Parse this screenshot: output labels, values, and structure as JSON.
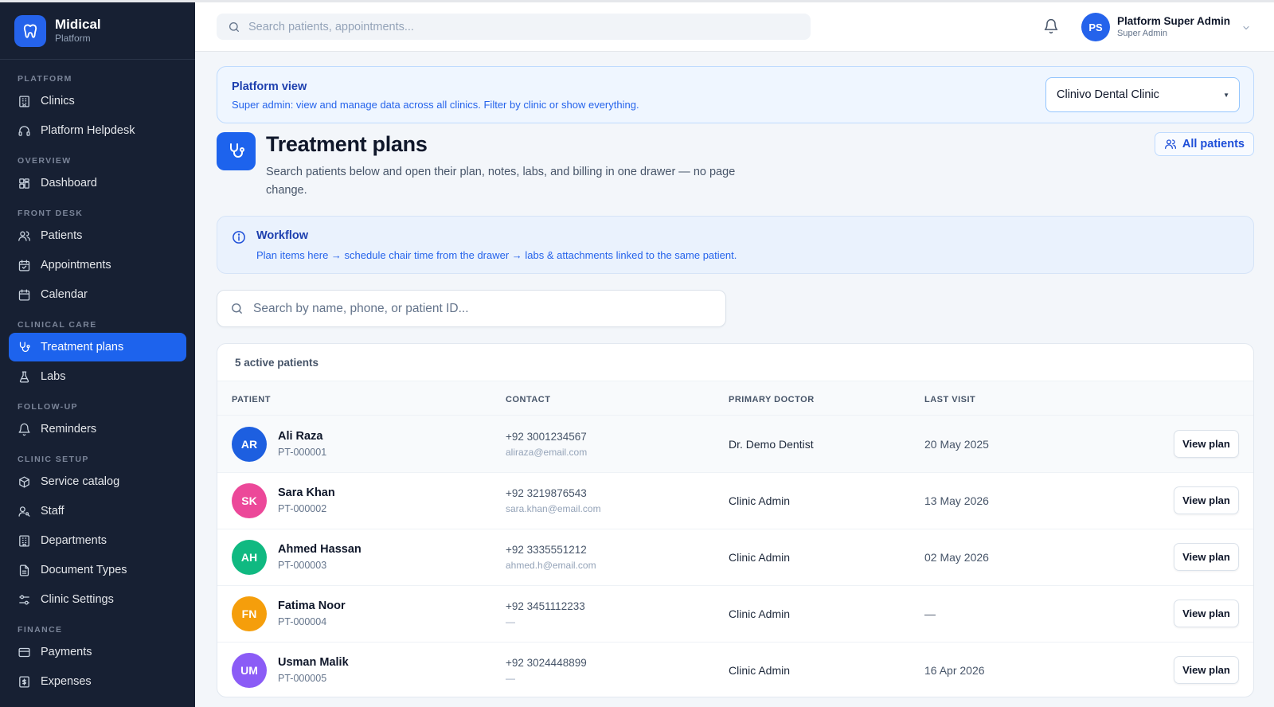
{
  "brand": {
    "name": "Midical",
    "subtitle": "Platform"
  },
  "sidebar": {
    "sections": [
      {
        "title": "PLATFORM",
        "items": [
          {
            "label": "Clinics",
            "icon": "building-icon"
          },
          {
            "label": "Platform Helpdesk",
            "icon": "headset-icon"
          }
        ]
      },
      {
        "title": "OVERVIEW",
        "items": [
          {
            "label": "Dashboard",
            "icon": "grid-icon"
          }
        ]
      },
      {
        "title": "FRONT DESK",
        "items": [
          {
            "label": "Patients",
            "icon": "users-icon"
          },
          {
            "label": "Appointments",
            "icon": "calendar-check-icon"
          },
          {
            "label": "Calendar",
            "icon": "calendar-icon"
          }
        ]
      },
      {
        "title": "CLINICAL CARE",
        "items": [
          {
            "label": "Treatment plans",
            "icon": "stethoscope-icon",
            "active": true
          },
          {
            "label": "Labs",
            "icon": "flask-icon"
          }
        ]
      },
      {
        "title": "FOLLOW-UP",
        "items": [
          {
            "label": "Reminders",
            "icon": "bell-icon"
          }
        ]
      },
      {
        "title": "CLINIC SETUP",
        "items": [
          {
            "label": "Service catalog",
            "icon": "package-icon"
          },
          {
            "label": "Staff",
            "icon": "user-key-icon"
          },
          {
            "label": "Departments",
            "icon": "building-icon"
          },
          {
            "label": "Document Types",
            "icon": "document-icon"
          },
          {
            "label": "Clinic Settings",
            "icon": "sliders-icon"
          }
        ]
      },
      {
        "title": "FINANCE",
        "items": [
          {
            "label": "Payments",
            "icon": "credit-card-icon"
          },
          {
            "label": "Expenses",
            "icon": "receipt-icon"
          }
        ]
      }
    ]
  },
  "topbar": {
    "search_placeholder": "Search patients, appointments...",
    "user": {
      "initials": "PS",
      "name": "Platform Super Admin",
      "role": "Super Admin"
    }
  },
  "platform_view": {
    "title": "Platform view",
    "description": "Super admin: view and manage data across all clinics. Filter by clinic or show everything.",
    "selected_clinic": "Clinivo Dental Clinic"
  },
  "page": {
    "title": "Treatment plans",
    "description": "Search patients below and open their plan, notes, labs, and billing in one drawer — no page change.",
    "all_patients_label": "All patients"
  },
  "workflow": {
    "title": "Workflow",
    "description": "Plan items here → schedule chair time from the drawer → labs & attachments linked to the same patient."
  },
  "patient_search": {
    "placeholder": "Search by name, phone, or patient ID..."
  },
  "table": {
    "count_label": "5 active patients",
    "headers": {
      "patient": "PATIENT",
      "contact": "CONTACT",
      "doctor": "PRIMARY DOCTOR",
      "last_visit": "LAST VISIT"
    },
    "action_label": "View plan",
    "rows": [
      {
        "initials": "AR",
        "color": "#1d5fe0",
        "name": "Ali Raza",
        "id": "PT-000001",
        "phone": "+92 3001234567",
        "email": "aliraza@email.com",
        "doctor": "Dr. Demo Dentist",
        "last_visit": "20 May 2025"
      },
      {
        "initials": "SK",
        "color": "#ec4899",
        "name": "Sara Khan",
        "id": "PT-000002",
        "phone": "+92 3219876543",
        "email": "sara.khan@email.com",
        "doctor": "Clinic Admin",
        "last_visit": "13 May 2026"
      },
      {
        "initials": "AH",
        "color": "#10b981",
        "name": "Ahmed Hassan",
        "id": "PT-000003",
        "phone": "+92 3335551212",
        "email": "ahmed.h@email.com",
        "doctor": "Clinic Admin",
        "last_visit": "02 May 2026"
      },
      {
        "initials": "FN",
        "color": "#f59e0b",
        "name": "Fatima Noor",
        "id": "PT-000004",
        "phone": "+92 3451112233",
        "email": "—",
        "doctor": "Clinic Admin",
        "last_visit": "—"
      },
      {
        "initials": "UM",
        "color": "#8b5cf6",
        "name": "Usman Malik",
        "id": "PT-000005",
        "phone": "+92 3024448899",
        "email": "—",
        "doctor": "Clinic Admin",
        "last_visit": "16 Apr 2026"
      }
    ]
  }
}
